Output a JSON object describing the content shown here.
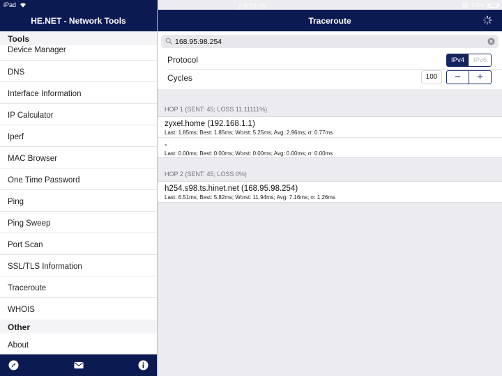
{
  "status_bar": {
    "device": "iPad",
    "time": "上午12:05",
    "battery": "34%",
    "battery_level": 0.34
  },
  "sidebar": {
    "title": "HE.NET - Network Tools",
    "sections": [
      {
        "header": "Tools",
        "items": [
          "Device Manager",
          "DNS",
          "Interface Information",
          "IP Calculator",
          "Iperf",
          "MAC Browser",
          "One Time Password",
          "Ping",
          "Ping Sweep",
          "Port Scan",
          "SSL/TLS Information",
          "Traceroute",
          "WHOIS"
        ]
      },
      {
        "header": "Other",
        "items": [
          "About"
        ]
      }
    ],
    "tabbar_icons": [
      "compass-icon",
      "mail-icon",
      "info-icon"
    ]
  },
  "detail": {
    "title": "Traceroute",
    "search": {
      "value": "168.95.98.254",
      "placeholder": ""
    },
    "protocol": {
      "label": "Protocol",
      "options": [
        "IPv4",
        "IPv6"
      ],
      "selected": "IPv4"
    },
    "cycles": {
      "label": "Cycles",
      "value": "100",
      "decrement": "−",
      "increment": "+"
    },
    "hops": [
      {
        "header": "HOP 1 (SENT: 45; LOSS 11.11111%)",
        "rows": [
          {
            "host": "zyxel.home (192.168.1.1)",
            "stats": "Last: 1.85ms; Best: 1.85ms; Worst: 5.25ms; Avg: 2.96ms; σ: 0.77ms"
          },
          {
            "host": "-",
            "stats": "Last: 0.00ms; Best: 0.00ms; Worst: 0.00ms; Avg: 0.00ms; σ: 0.00ms"
          }
        ]
      },
      {
        "header": "HOP 2 (SENT: 45; LOSS 0%)",
        "rows": [
          {
            "host": "h254.s98.ts.hinet.net (168.95.98.254)",
            "stats": "Last: 6.51ms; Best: 5.82ms; Worst: 11.94ms; Avg: 7.16ms; σ: 1.26ms"
          }
        ]
      }
    ]
  }
}
